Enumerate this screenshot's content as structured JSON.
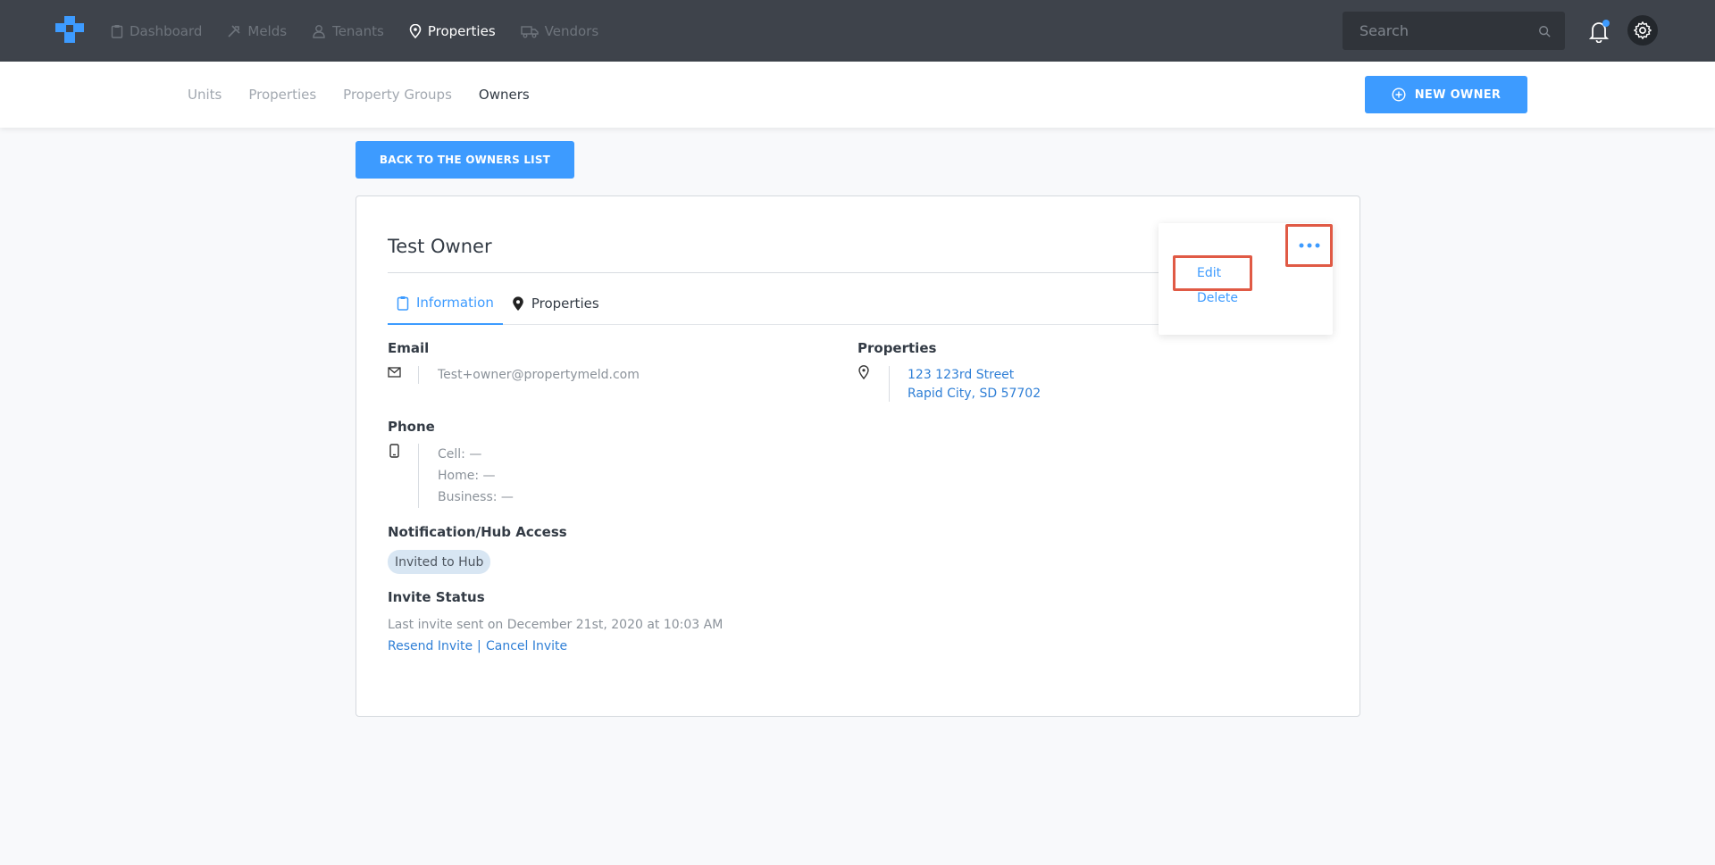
{
  "nav": {
    "items": [
      {
        "label": "Dashboard",
        "icon": "clipboard-icon"
      },
      {
        "label": "Melds",
        "icon": "tools-icon"
      },
      {
        "label": "Tenants",
        "icon": "person-icon"
      },
      {
        "label": "Properties",
        "icon": "map-pin-icon",
        "active": true
      },
      {
        "label": "Vendors",
        "icon": "truck-icon"
      }
    ],
    "search_placeholder": "Search"
  },
  "subnav": {
    "tabs": [
      "Units",
      "Properties",
      "Property Groups",
      "Owners"
    ],
    "active_tab": "Owners",
    "new_owner_label": "NEW OWNER"
  },
  "back_label": "BACK TO THE OWNERS LIST",
  "owner": {
    "name": "Test Owner",
    "tabs": [
      "Information",
      "Properties"
    ],
    "email_label": "Email",
    "email": "Test+owner@propertymeld.com",
    "phone_label": "Phone",
    "phone_cell": "Cell: —",
    "phone_home": "Home: —",
    "phone_business": "Business: —",
    "properties_label": "Properties",
    "address_line1": "123 123rd Street",
    "address_line2": "Rapid City, SD 57702",
    "hub_label": "Notification/Hub Access",
    "hub_badge": "Invited to Hub",
    "invite_label": "Invite Status",
    "invite_text": "Last invite sent on December 21st, 2020 at 10:03 AM",
    "resend_label": "Resend Invite",
    "separator": "|",
    "cancel_label": "Cancel Invite"
  },
  "menu": {
    "edit_label": "Edit",
    "delete_label": "Delete"
  },
  "colors": {
    "accent": "#3d9bff",
    "topbar": "#3e434b",
    "highlight": "#e05a45"
  }
}
